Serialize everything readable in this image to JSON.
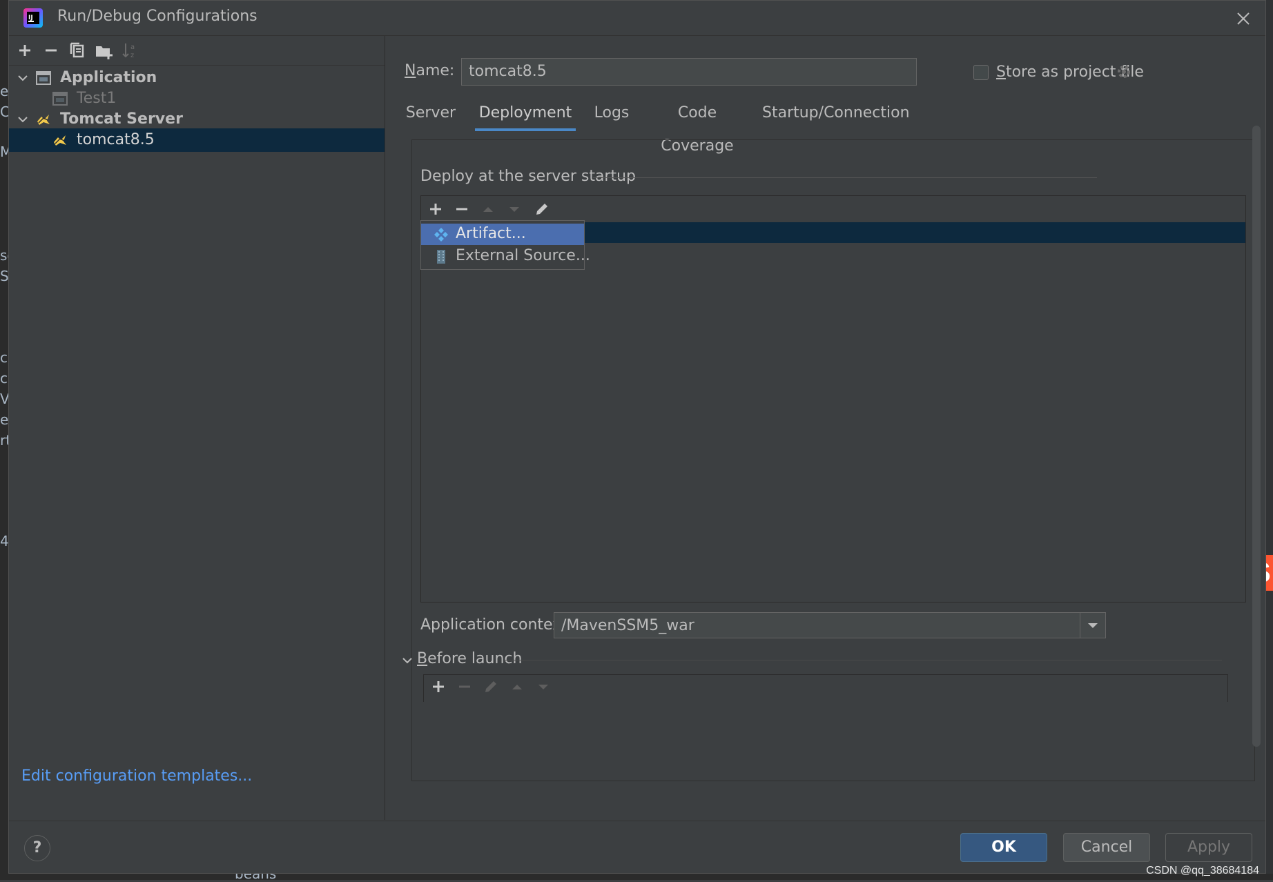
{
  "background": {
    "left_strip_fragments": [
      "er",
      "Co",
      "M",
      "se",
      "Se",
      "c",
      "c",
      "V",
      "es",
      "rt",
      "4"
    ],
    "bottom_text": "beans",
    "watermark": "CSDN @qq_38684184"
  },
  "dialog": {
    "title": "Run/Debug Configurations",
    "app_icon": "intellij-idea-icon",
    "close_icon": "close-icon"
  },
  "left_panel": {
    "toolbar": [
      "add-icon",
      "remove-icon",
      "copy-icon",
      "new-folder-icon",
      "sort-icon"
    ],
    "tree": [
      {
        "label": "Application",
        "icon": "application-icon",
        "expanded": true,
        "level": 0
      },
      {
        "label": "Test1",
        "icon": "application-icon",
        "level": 1,
        "disabled": true
      },
      {
        "label": "Tomcat Server",
        "icon": "tomcat-icon",
        "expanded": true,
        "level": 0
      },
      {
        "label": "tomcat8.5",
        "icon": "tomcat-icon",
        "level": 1,
        "selected": true
      }
    ],
    "edit_templates_link": "Edit configuration templates..."
  },
  "right_panel": {
    "name_label_rest": "ame:",
    "name_label_mnemonic": "N",
    "name_value": "tomcat8.5",
    "store_mnemonic": "S",
    "store_label_rest": "tore as project file",
    "store_checked": false,
    "tabs": [
      {
        "label": "Server",
        "active": false
      },
      {
        "label": "Deployment",
        "active": true
      },
      {
        "label": "Logs",
        "active": false
      },
      {
        "label": "Code Coverage",
        "active": false
      },
      {
        "label": "Startup/Connection",
        "active": false
      }
    ],
    "deploy_title": "Deploy at the server startup",
    "deploy_toolbar": [
      "add-icon",
      "remove-icon",
      "move-up-icon",
      "move-down-icon",
      "edit-icon"
    ],
    "popup_menu": [
      {
        "label": "Artifact...",
        "icon": "artifact-icon",
        "selected": true
      },
      {
        "label": "External Source...",
        "icon": "external-source-icon",
        "selected": false
      }
    ],
    "app_context_label": "Application context:",
    "app_context_value": "/MavenSSM5_war",
    "before_launch_mnemonic": "B",
    "before_launch_rest": "efore launch",
    "before_launch_toolbar": [
      "add-icon",
      "remove-icon",
      "edit-icon",
      "move-up-icon",
      "move-down-icon"
    ]
  },
  "footer": {
    "help": "?",
    "ok": "OK",
    "cancel": "Cancel",
    "apply": "Apply"
  },
  "colors": {
    "dialog_bg": "#3c3f41",
    "selection": "#0d293e",
    "popup_selection": "#4b6eaf",
    "accent_tab": "#4a88c7",
    "link": "#589df6",
    "ok_button": "#365880"
  }
}
